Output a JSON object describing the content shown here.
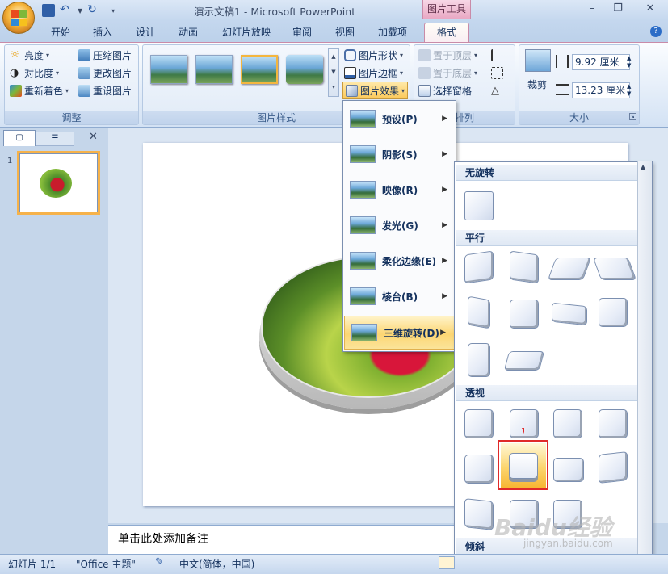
{
  "window": {
    "title": "演示文稿1 - Microsoft PowerPoint",
    "contextual_tab_header": "图片工具"
  },
  "tabs": [
    "开始",
    "插入",
    "设计",
    "动画",
    "幻灯片放映",
    "审阅",
    "视图",
    "加载项",
    "格式"
  ],
  "ribbon": {
    "adjust": {
      "label": "调整",
      "brightness": "亮度",
      "contrast": "对比度",
      "recolor": "重新着色",
      "compress": "压缩图片",
      "change_picture": "更改图片",
      "reset_picture": "重设图片"
    },
    "picture_styles": {
      "label": "图片样式",
      "shape": "图片形状",
      "border": "图片边框",
      "effects": "图片效果"
    },
    "arrange": {
      "label": "排列",
      "bring_front": "置于顶层",
      "send_back": "置于底层",
      "selection_pane": "选择窗格"
    },
    "size": {
      "label": "大小",
      "crop": "裁剪",
      "height": "9.92 厘米",
      "width": "13.23 厘米"
    }
  },
  "effects_menu": {
    "items": [
      "预设(P)",
      "阴影(S)",
      "映像(R)",
      "发光(G)",
      "柔化边缘(E)",
      "棱台(B)",
      "三维旋转(D)"
    ]
  },
  "rotation_gallery": {
    "sections": [
      "无旋转",
      "平行",
      "透视",
      "倾斜"
    ]
  },
  "slides_pane": {
    "slide_number": "1"
  },
  "notes": {
    "placeholder": "单击此处添加备注"
  },
  "status": {
    "slide": "幻灯片 1/1",
    "theme": "\"Office 主题\"",
    "language": "中文(简体，中国)"
  },
  "watermark": {
    "brand": "Baidu经验",
    "url": "jingyan.baidu.com"
  }
}
